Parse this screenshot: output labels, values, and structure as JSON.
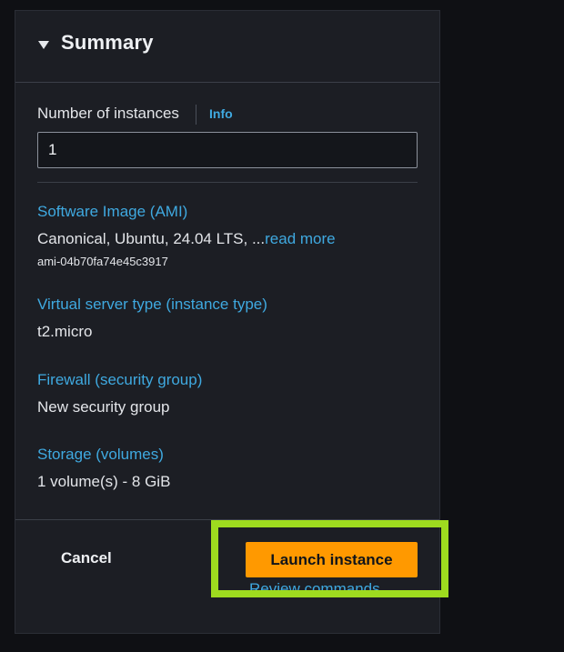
{
  "summary": {
    "title": "Summary",
    "number_of_instances_label": "Number of instances",
    "info_link": "Info",
    "number_of_instances_value": "1",
    "software_image": {
      "label": "Software Image (AMI)",
      "value": "Canonical, Ubuntu, 24.04 LTS, ...",
      "read_more": "read more",
      "ami_id": "ami-04b70fa74e45c3917"
    },
    "instance_type": {
      "label": "Virtual server type (instance type)",
      "value": "t2.micro"
    },
    "firewall": {
      "label": "Firewall (security group)",
      "value": "New security group"
    },
    "storage": {
      "label": "Storage (volumes)",
      "value": "1 volume(s) - 8 GiB"
    }
  },
  "footer": {
    "cancel_label": "Cancel",
    "launch_label": "Launch instance",
    "review_label": "Review commands"
  },
  "colors": {
    "panel_bg": "#1c1e24",
    "link": "#3fa9e0",
    "primary_button": "#ff9900",
    "highlight": "#9edb1f"
  }
}
